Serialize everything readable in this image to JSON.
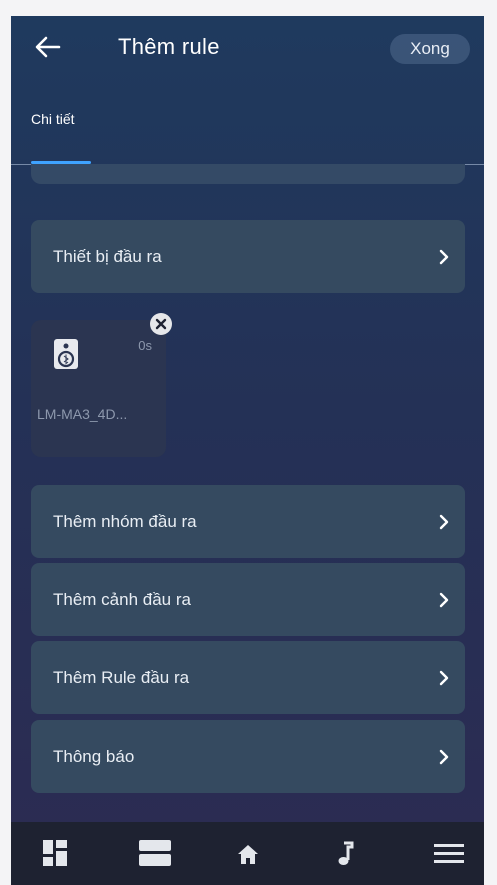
{
  "header": {
    "title": "Thêm rule",
    "done_label": "Xong",
    "back_icon": "arrow-left-icon"
  },
  "tabs": [
    {
      "label": "Chi tiết",
      "active": true
    }
  ],
  "output_device_row": {
    "label": "Thiết bị đầu ra"
  },
  "device_card": {
    "name": "LM-MA3_4D...",
    "duration": "0s",
    "icon": "speaker-icon"
  },
  "menu_rows": [
    {
      "label": "Thêm nhóm đầu ra"
    },
    {
      "label": "Thêm cảnh đầu ra"
    },
    {
      "label": "Thêm Rule đầu ra"
    },
    {
      "label": "Thông báo"
    }
  ],
  "bottom_nav": {
    "items": [
      "dashboard-icon",
      "devices-icon",
      "home-icon",
      "music-icon",
      "menu-icon"
    ]
  },
  "colors": {
    "accent": "#3fa3ff",
    "row_bg": "#354a60",
    "nav_bg": "#1e2231"
  }
}
